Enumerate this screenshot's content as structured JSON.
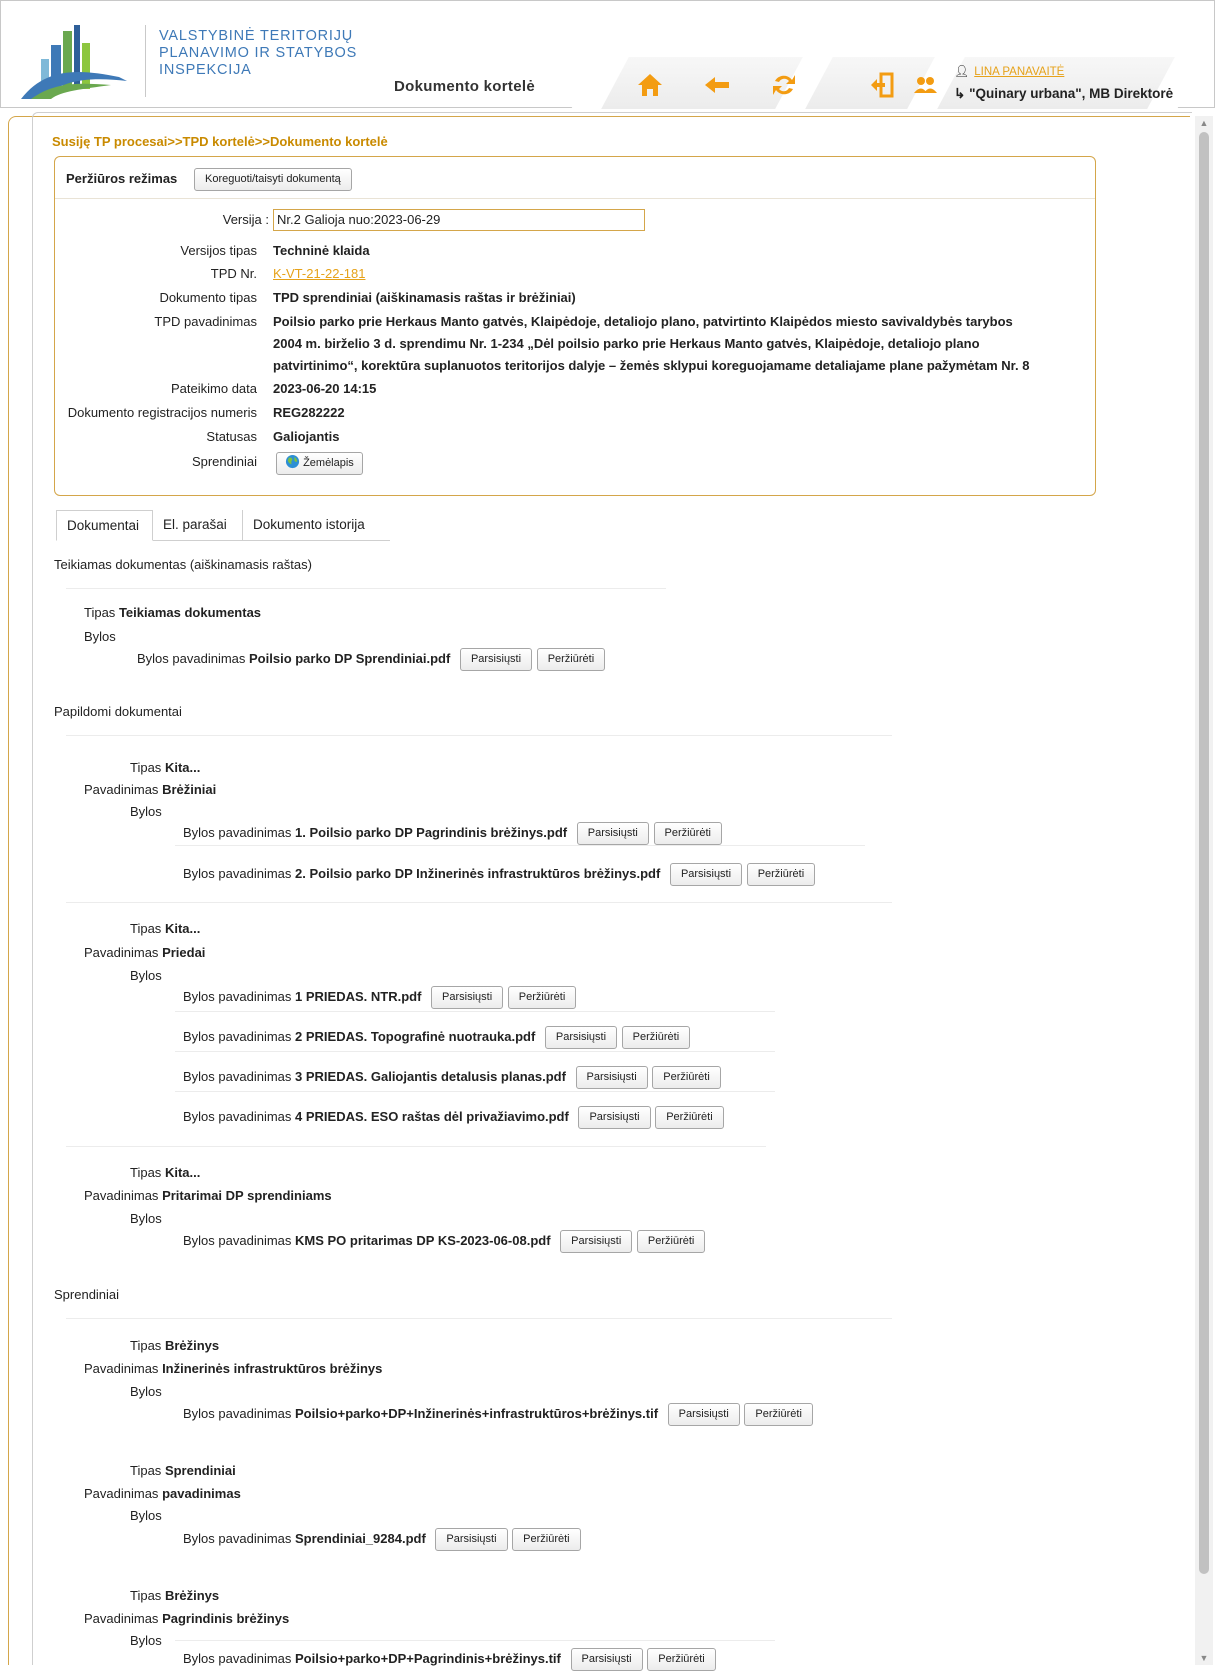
{
  "header": {
    "org_lines": [
      "VALSTYBINĖ TERITORIJŲ",
      "PLANAVIMO IR STATYBOS",
      "INSPEKCIJA"
    ],
    "page_title": "Dokumento kortelė",
    "user_name": "LINA PANAVAITĖ",
    "user_role": "\"Quinary urbana\", MB Direktorė",
    "accent_color": "#f39c12"
  },
  "breadcrumb": "Susiję TP procesai>>TPD kortelė>>Dokumento kortelė",
  "card": {
    "mode_label": "Peržiūros režimas",
    "edit_button": "Koreguoti/taisyti dokumentą",
    "fields": {
      "versija_label": "Versija",
      "versija_value": "Nr.2 Galioja nuo:2023-06-29",
      "versijos_tipas_label": "Versijos tipas",
      "versijos_tipas_value": "Techninė klaida",
      "tpd_nr_label": "TPD Nr.",
      "tpd_nr_value": "K-VT-21-22-181",
      "dokumento_tipas_label": "Dokumento tipas",
      "dokumento_tipas_value": "TPD sprendiniai (aiškinamasis raštas ir brėžiniai)",
      "tpd_pavadinimas_label": "TPD pavadinimas",
      "tpd_pavadinimas_lines": [
        "Poilsio parko prie Herkaus Manto gatvės, Klaipėdoje, detaliojo plano, patvirtinto Klaipėdos miesto savivaldybės tarybos",
        "2004 m. birželio 3 d. sprendimu Nr. 1-234 „Dėl poilsio parko prie Herkaus Manto gatvės, Klaipėdoje, detaliojo plano",
        "patvirtinimo“, korektūra suplanuotos teritorijos dalyje – žemės sklypui koreguojamame detaliajame plane pažymėtam Nr. 8"
      ],
      "pateikimo_data_label": "Pateikimo data",
      "pateikimo_data_value": "2023-06-20 14:15",
      "reg_nr_label": "Dokumento registracijos numeris",
      "reg_nr_value": "REG282222",
      "statusas_label": "Statusas",
      "statusas_value": "Galiojantis",
      "sprendiniai_label": "Sprendiniai",
      "zemelapis_button": "Žemėlapis"
    }
  },
  "tabs": [
    "Dokumentai",
    "El. parašai",
    "Dokumento istorija"
  ],
  "labels": {
    "tipas": "Tipas",
    "pavadinimas": "Pavadinimas",
    "bylos": "Bylos",
    "bylos_pavadinimas": "Bylos pavadinimas",
    "download": "Parsisiųsti",
    "view": "Peržiūrėti"
  },
  "sections": {
    "teikiamas_title": "Teikiamas dokumentas (aiškinamasis raštas)",
    "teikiamas_tipas": "Teikiamas dokumentas",
    "teikiamas_file": "Poilsio parko DP Sprendiniai.pdf",
    "papildomi_title": "Papildomi dokumentai",
    "p1_tipas": "Kita...",
    "p1_pavadinimas": "Brėžiniai",
    "p1_files": [
      "1. Poilsio parko DP Pagrindinis brėžinys.pdf",
      "2. Poilsio parko DP Inžinerinės infrastruktūros brėžinys.pdf"
    ],
    "p2_tipas": "Kita...",
    "p2_pavadinimas": "Priedai",
    "p2_files": [
      "1 PRIEDAS. NTR.pdf",
      "2 PRIEDAS. Topografinė nuotrauka.pdf",
      "3 PRIEDAS. Galiojantis detalusis planas.pdf",
      "4 PRIEDAS. ESO raštas dėl privažiavimo.pdf"
    ],
    "p3_tipas": "Kita...",
    "p3_pavadinimas": "Pritarimai DP sprendiniams",
    "p3_files": [
      "KMS PO pritarimas DP KS-2023-06-08.pdf"
    ],
    "sprendiniai_title": "Sprendiniai",
    "s1_tipas": "Brėžinys",
    "s1_pavadinimas": "Inžinerinės infrastruktūros brėžinys",
    "s1_files": [
      "Poilsio+parko+DP+Inžinerinės+infrastruktūros+brėžinys.tif"
    ],
    "s2_tipas": "Sprendiniai",
    "s2_pavadinimas": "pavadinimas",
    "s2_files": [
      "Sprendiniai_9284.pdf"
    ],
    "s3_tipas": "Brėžinys",
    "s3_pavadinimas": "Pagrindinis brėžinys",
    "s3_files": [
      "Poilsio+parko+DP+Pagrindinis+brėžinys.tif"
    ]
  }
}
